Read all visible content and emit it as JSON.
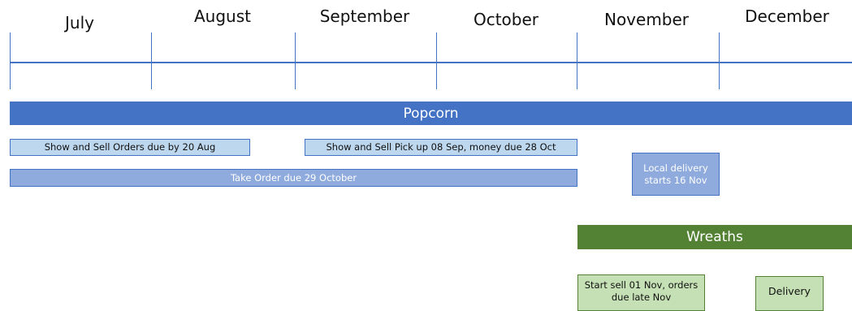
{
  "timeline": {
    "months": [
      "July",
      "August",
      "September",
      "October",
      "November",
      "December"
    ]
  },
  "popcorn": {
    "title": "Popcorn",
    "show_sell_orders": "Show and Sell Orders due by 20 Aug",
    "show_sell_pickup": "Show and Sell Pick up 08 Sep, money due 28 Oct",
    "take_order": "Take Order due 29 October",
    "local_delivery_line1": "Local delivery",
    "local_delivery_line2": "starts 16 Nov"
  },
  "wreaths": {
    "title": "Wreaths",
    "start_sell_line1": "Start sell 01 Nov, orders",
    "start_sell_line2": "due late Nov",
    "delivery": "Delivery"
  },
  "colors": {
    "timeline_blue": "#4472c4",
    "popcorn_bar": "#4472c4",
    "light_blue_box": "#bdd7ee",
    "medium_blue_box": "#8faadc",
    "wreaths_bar": "#548235",
    "light_green_box": "#c5e0b4"
  }
}
